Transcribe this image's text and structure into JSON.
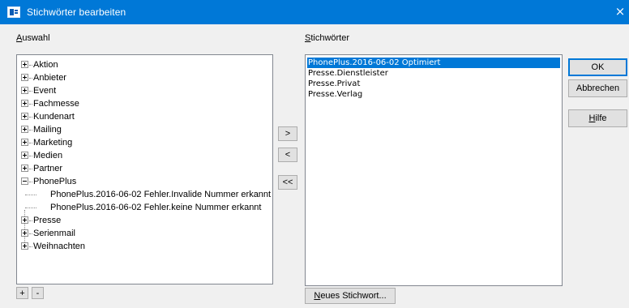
{
  "window": {
    "title": "Stichwörter bearbeiten",
    "close_glyph": "×"
  },
  "left": {
    "label_prefix": "A",
    "label_rest": "uswahl",
    "tree": [
      {
        "label": "Aktion",
        "state": "collapsed"
      },
      {
        "label": "Anbieter",
        "state": "collapsed"
      },
      {
        "label": "Event",
        "state": "collapsed"
      },
      {
        "label": "Fachmesse",
        "state": "collapsed"
      },
      {
        "label": "Kundenart",
        "state": "collapsed"
      },
      {
        "label": "Mailing",
        "state": "collapsed"
      },
      {
        "label": "Marketing",
        "state": "collapsed"
      },
      {
        "label": "Medien",
        "state": "collapsed"
      },
      {
        "label": "Partner",
        "state": "collapsed"
      },
      {
        "label": "PhonePlus",
        "state": "expanded"
      },
      {
        "label": "PhonePlus.2016-06-02 Fehler.Invalide Nummer erkannt",
        "state": "child"
      },
      {
        "label": "PhonePlus.2016-06-02 Fehler.keine Nummer erkannt",
        "state": "child"
      },
      {
        "label": "Presse",
        "state": "collapsed"
      },
      {
        "label": "Serienmail",
        "state": "collapsed"
      },
      {
        "label": "Weihnachten",
        "state": "collapsed"
      }
    ],
    "add_btn": "+",
    "remove_btn": "-"
  },
  "middle": {
    "add_btn": ">",
    "remove_btn": "<",
    "remove_all_btn": "<<"
  },
  "right": {
    "label_prefix": "S",
    "label_rest": "tichwörter",
    "items": [
      {
        "label": "PhonePlus.2016-06-02 Optimiert",
        "selected": true
      },
      {
        "label": "Presse.Dienstleister",
        "selected": false
      },
      {
        "label": "Presse.Privat",
        "selected": false
      },
      {
        "label": "Presse.Verlag",
        "selected": false
      }
    ],
    "new_btn_prefix": "N",
    "new_btn_rest": "eues Stichwort..."
  },
  "buttons": {
    "ok": "OK",
    "cancel": "Abbrechen",
    "help_prefix": "H",
    "help_rest": "ilfe"
  },
  "colors": {
    "titlebar": "#0078d7",
    "selection": "#0078d7",
    "dialog_bg": "#f0f0f0"
  }
}
